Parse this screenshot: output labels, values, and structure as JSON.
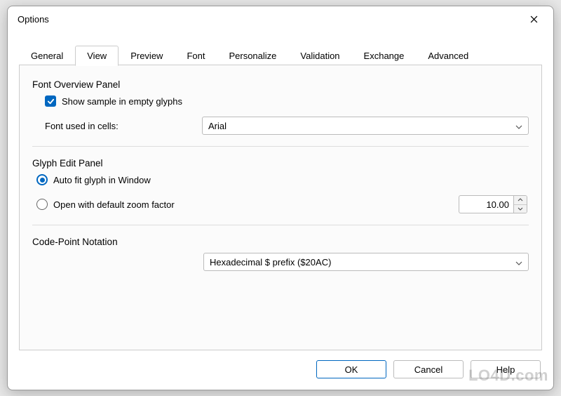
{
  "window": {
    "title": "Options"
  },
  "tabs": [
    {
      "label": "General"
    },
    {
      "label": "View"
    },
    {
      "label": "Preview"
    },
    {
      "label": "Font"
    },
    {
      "label": "Personalize"
    },
    {
      "label": "Validation"
    },
    {
      "label": "Exchange"
    },
    {
      "label": "Advanced"
    }
  ],
  "active_tab_index": 1,
  "font_overview": {
    "group_label": "Font Overview Panel",
    "show_sample_label": "Show sample in empty glyphs",
    "show_sample_checked": true,
    "font_cells_label": "Font used in cells:",
    "font_cells_value": "Arial"
  },
  "glyph_edit": {
    "group_label": "Glyph Edit Panel",
    "auto_fit_label": "Auto fit glyph in Window",
    "open_zoom_label": "Open with default zoom factor",
    "radio_selected": "auto_fit",
    "zoom_value": "10.00"
  },
  "code_point": {
    "group_label": "Code-Point Notation",
    "value": "Hexadecimal $ prefix ($20AC)"
  },
  "buttons": {
    "ok": "OK",
    "cancel": "Cancel",
    "help": "Help"
  },
  "watermark": "LO4D.com"
}
